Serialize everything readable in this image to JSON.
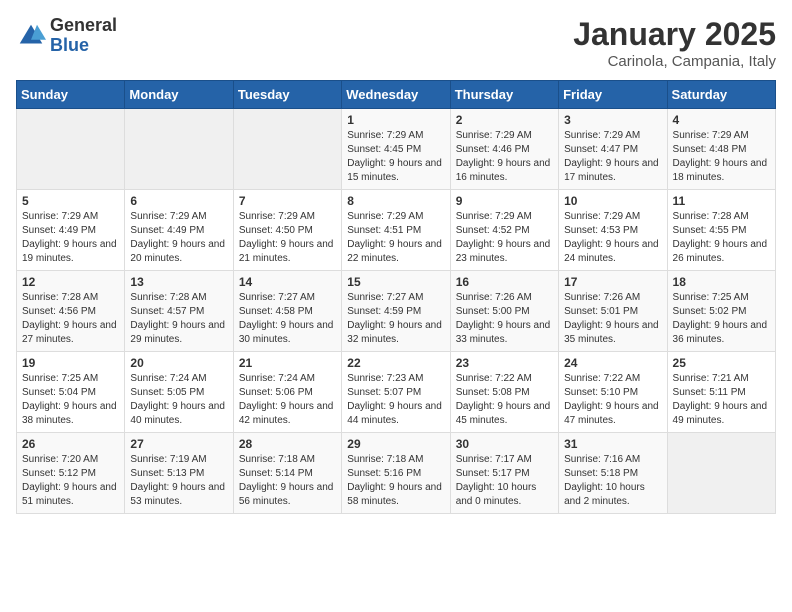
{
  "logo": {
    "general": "General",
    "blue": "Blue"
  },
  "title": "January 2025",
  "subtitle": "Carinola, Campania, Italy",
  "weekdays": [
    "Sunday",
    "Monday",
    "Tuesday",
    "Wednesday",
    "Thursday",
    "Friday",
    "Saturday"
  ],
  "weeks": [
    [
      {
        "day": "",
        "sunrise": "",
        "sunset": "",
        "daylight": ""
      },
      {
        "day": "",
        "sunrise": "",
        "sunset": "",
        "daylight": ""
      },
      {
        "day": "",
        "sunrise": "",
        "sunset": "",
        "daylight": ""
      },
      {
        "day": "1",
        "sunrise": "Sunrise: 7:29 AM",
        "sunset": "Sunset: 4:45 PM",
        "daylight": "Daylight: 9 hours and 15 minutes."
      },
      {
        "day": "2",
        "sunrise": "Sunrise: 7:29 AM",
        "sunset": "Sunset: 4:46 PM",
        "daylight": "Daylight: 9 hours and 16 minutes."
      },
      {
        "day": "3",
        "sunrise": "Sunrise: 7:29 AM",
        "sunset": "Sunset: 4:47 PM",
        "daylight": "Daylight: 9 hours and 17 minutes."
      },
      {
        "day": "4",
        "sunrise": "Sunrise: 7:29 AM",
        "sunset": "Sunset: 4:48 PM",
        "daylight": "Daylight: 9 hours and 18 minutes."
      }
    ],
    [
      {
        "day": "5",
        "sunrise": "Sunrise: 7:29 AM",
        "sunset": "Sunset: 4:49 PM",
        "daylight": "Daylight: 9 hours and 19 minutes."
      },
      {
        "day": "6",
        "sunrise": "Sunrise: 7:29 AM",
        "sunset": "Sunset: 4:49 PM",
        "daylight": "Daylight: 9 hours and 20 minutes."
      },
      {
        "day": "7",
        "sunrise": "Sunrise: 7:29 AM",
        "sunset": "Sunset: 4:50 PM",
        "daylight": "Daylight: 9 hours and 21 minutes."
      },
      {
        "day": "8",
        "sunrise": "Sunrise: 7:29 AM",
        "sunset": "Sunset: 4:51 PM",
        "daylight": "Daylight: 9 hours and 22 minutes."
      },
      {
        "day": "9",
        "sunrise": "Sunrise: 7:29 AM",
        "sunset": "Sunset: 4:52 PM",
        "daylight": "Daylight: 9 hours and 23 minutes."
      },
      {
        "day": "10",
        "sunrise": "Sunrise: 7:29 AM",
        "sunset": "Sunset: 4:53 PM",
        "daylight": "Daylight: 9 hours and 24 minutes."
      },
      {
        "day": "11",
        "sunrise": "Sunrise: 7:28 AM",
        "sunset": "Sunset: 4:55 PM",
        "daylight": "Daylight: 9 hours and 26 minutes."
      }
    ],
    [
      {
        "day": "12",
        "sunrise": "Sunrise: 7:28 AM",
        "sunset": "Sunset: 4:56 PM",
        "daylight": "Daylight: 9 hours and 27 minutes."
      },
      {
        "day": "13",
        "sunrise": "Sunrise: 7:28 AM",
        "sunset": "Sunset: 4:57 PM",
        "daylight": "Daylight: 9 hours and 29 minutes."
      },
      {
        "day": "14",
        "sunrise": "Sunrise: 7:27 AM",
        "sunset": "Sunset: 4:58 PM",
        "daylight": "Daylight: 9 hours and 30 minutes."
      },
      {
        "day": "15",
        "sunrise": "Sunrise: 7:27 AM",
        "sunset": "Sunset: 4:59 PM",
        "daylight": "Daylight: 9 hours and 32 minutes."
      },
      {
        "day": "16",
        "sunrise": "Sunrise: 7:26 AM",
        "sunset": "Sunset: 5:00 PM",
        "daylight": "Daylight: 9 hours and 33 minutes."
      },
      {
        "day": "17",
        "sunrise": "Sunrise: 7:26 AM",
        "sunset": "Sunset: 5:01 PM",
        "daylight": "Daylight: 9 hours and 35 minutes."
      },
      {
        "day": "18",
        "sunrise": "Sunrise: 7:25 AM",
        "sunset": "Sunset: 5:02 PM",
        "daylight": "Daylight: 9 hours and 36 minutes."
      }
    ],
    [
      {
        "day": "19",
        "sunrise": "Sunrise: 7:25 AM",
        "sunset": "Sunset: 5:04 PM",
        "daylight": "Daylight: 9 hours and 38 minutes."
      },
      {
        "day": "20",
        "sunrise": "Sunrise: 7:24 AM",
        "sunset": "Sunset: 5:05 PM",
        "daylight": "Daylight: 9 hours and 40 minutes."
      },
      {
        "day": "21",
        "sunrise": "Sunrise: 7:24 AM",
        "sunset": "Sunset: 5:06 PM",
        "daylight": "Daylight: 9 hours and 42 minutes."
      },
      {
        "day": "22",
        "sunrise": "Sunrise: 7:23 AM",
        "sunset": "Sunset: 5:07 PM",
        "daylight": "Daylight: 9 hours and 44 minutes."
      },
      {
        "day": "23",
        "sunrise": "Sunrise: 7:22 AM",
        "sunset": "Sunset: 5:08 PM",
        "daylight": "Daylight: 9 hours and 45 minutes."
      },
      {
        "day": "24",
        "sunrise": "Sunrise: 7:22 AM",
        "sunset": "Sunset: 5:10 PM",
        "daylight": "Daylight: 9 hours and 47 minutes."
      },
      {
        "day": "25",
        "sunrise": "Sunrise: 7:21 AM",
        "sunset": "Sunset: 5:11 PM",
        "daylight": "Daylight: 9 hours and 49 minutes."
      }
    ],
    [
      {
        "day": "26",
        "sunrise": "Sunrise: 7:20 AM",
        "sunset": "Sunset: 5:12 PM",
        "daylight": "Daylight: 9 hours and 51 minutes."
      },
      {
        "day": "27",
        "sunrise": "Sunrise: 7:19 AM",
        "sunset": "Sunset: 5:13 PM",
        "daylight": "Daylight: 9 hours and 53 minutes."
      },
      {
        "day": "28",
        "sunrise": "Sunrise: 7:18 AM",
        "sunset": "Sunset: 5:14 PM",
        "daylight": "Daylight: 9 hours and 56 minutes."
      },
      {
        "day": "29",
        "sunrise": "Sunrise: 7:18 AM",
        "sunset": "Sunset: 5:16 PM",
        "daylight": "Daylight: 9 hours and 58 minutes."
      },
      {
        "day": "30",
        "sunrise": "Sunrise: 7:17 AM",
        "sunset": "Sunset: 5:17 PM",
        "daylight": "Daylight: 10 hours and 0 minutes."
      },
      {
        "day": "31",
        "sunrise": "Sunrise: 7:16 AM",
        "sunset": "Sunset: 5:18 PM",
        "daylight": "Daylight: 10 hours and 2 minutes."
      },
      {
        "day": "",
        "sunrise": "",
        "sunset": "",
        "daylight": ""
      }
    ]
  ]
}
